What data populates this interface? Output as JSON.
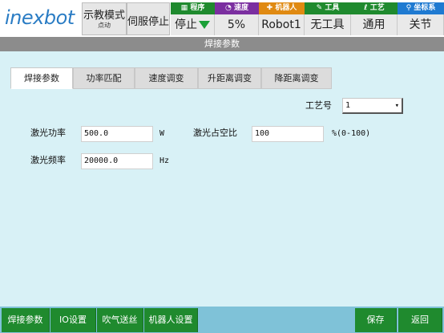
{
  "header": {
    "logo_text": "inexbot",
    "mode_label": "示教模式",
    "mode_sub": "点动",
    "servo_label": "伺服停止",
    "program": {
      "header": "程序",
      "value": "停止"
    },
    "speed": {
      "header": "速度",
      "value": "5%"
    },
    "robot": {
      "header": "机器人",
      "value": "Robot1"
    },
    "tool": {
      "header": "工具",
      "value": "无工具"
    },
    "process": {
      "header": "工艺",
      "value": "通用"
    },
    "coord": {
      "header": "坐标系",
      "value": "关节"
    }
  },
  "page_title": "焊接参数",
  "tabs": [
    "焊接参数",
    "功率匹配",
    "速度调变",
    "升距离调变",
    "降距离调变"
  ],
  "form": {
    "process_no": {
      "label": "工艺号",
      "value": "1"
    },
    "laser_power": {
      "label": "激光功率",
      "value": "500.0",
      "unit": "W"
    },
    "laser_duty": {
      "label": "激光占空比",
      "value": "100",
      "unit": "%(0-100)"
    },
    "laser_freq": {
      "label": "激光频率",
      "value": "20000.0",
      "unit": "Hz"
    }
  },
  "bottom": {
    "btn1": "焊接参数",
    "btn2": "IO设置",
    "btn3": "吹气送丝",
    "btn4": "机器人设置",
    "save": "保存",
    "back": "返回"
  },
  "colors": {
    "program_hdr": "#1f8a2e",
    "speed_hdr": "#7b2fa0",
    "robot_hdr": "#e08a12",
    "tool_hdr": "#1f8a2e",
    "process_hdr": "#1f8a2e",
    "coord_hdr": "#1f7ad1"
  }
}
